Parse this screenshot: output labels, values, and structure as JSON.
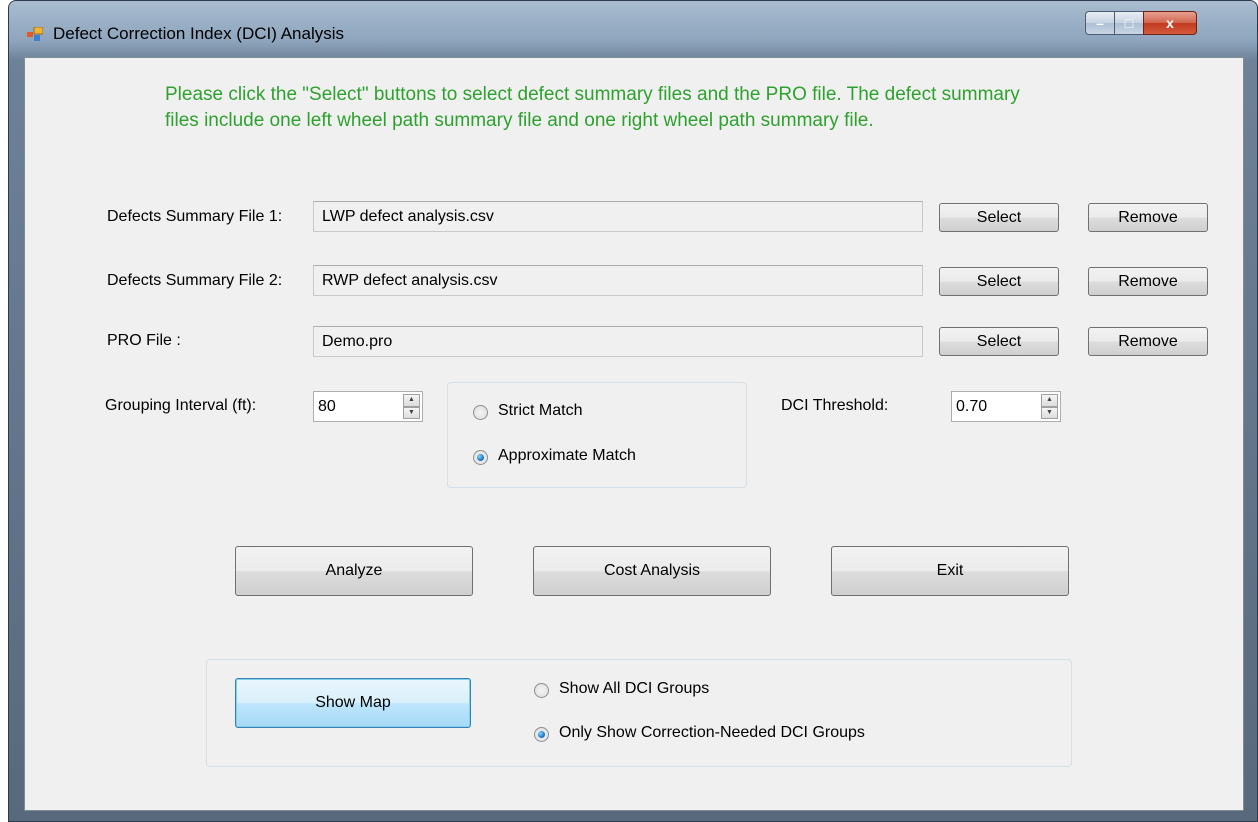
{
  "window": {
    "title": "Defect Correction Index (DCI) Analysis",
    "controls": {
      "minimize": "–",
      "maximize": "□",
      "close": "x"
    }
  },
  "instructions": "Please click the \"Select\" buttons to select defect summary files and the PRO file. The defect summary files include one left wheel path summary file and one right wheel path summary file.",
  "files": [
    {
      "label": "Defects Summary File 1:",
      "value": "LWP defect analysis.csv",
      "select": "Select",
      "remove": "Remove"
    },
    {
      "label": "Defects Summary File 2:",
      "value": "RWP defect analysis.csv",
      "select": "Select",
      "remove": "Remove"
    },
    {
      "label": "PRO File :",
      "value": "Demo.pro",
      "select": "Select",
      "remove": "Remove"
    }
  ],
  "grouping": {
    "label": "Grouping Interval (ft):",
    "value": "80"
  },
  "match": {
    "strict": {
      "label": "Strict Match",
      "checked": false
    },
    "approximate": {
      "label": "Approximate Match",
      "checked": true
    }
  },
  "threshold": {
    "label": "DCI Threshold:",
    "value": "0.70"
  },
  "actions": {
    "analyze": "Analyze",
    "cost": "Cost Analysis",
    "exit": "Exit"
  },
  "map": {
    "button": "Show Map",
    "show_all": {
      "label": "Show All DCI Groups",
      "checked": false
    },
    "only_needed": {
      "label": "Only Show Correction-Needed DCI Groups",
      "checked": true
    }
  },
  "colors": {
    "instruction_text": "#2ea12e",
    "client_bg": "#f0f0f0"
  }
}
